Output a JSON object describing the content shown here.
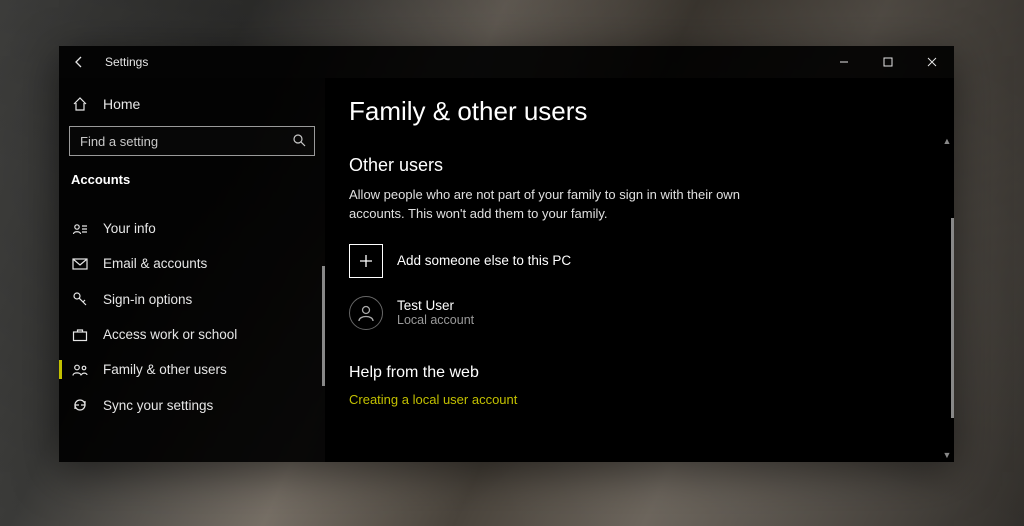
{
  "titlebar": {
    "title": "Settings"
  },
  "sidebar": {
    "home_label": "Home",
    "search_placeholder": "Find a setting",
    "section_label": "Accounts",
    "items": [
      {
        "label": "Your info"
      },
      {
        "label": "Email & accounts"
      },
      {
        "label": "Sign-in options"
      },
      {
        "label": "Access work or school"
      },
      {
        "label": "Family & other users"
      },
      {
        "label": "Sync your settings"
      }
    ]
  },
  "main": {
    "page_title": "Family & other users",
    "other_users": {
      "heading": "Other users",
      "description": "Allow people who are not part of your family to sign in with their own accounts. This won't add them to your family.",
      "add_label": "Add someone else to this PC",
      "users": [
        {
          "name": "Test User",
          "subtitle": "Local account"
        }
      ]
    },
    "help": {
      "heading": "Help from the web",
      "links": [
        "Creating a local user account"
      ]
    }
  }
}
